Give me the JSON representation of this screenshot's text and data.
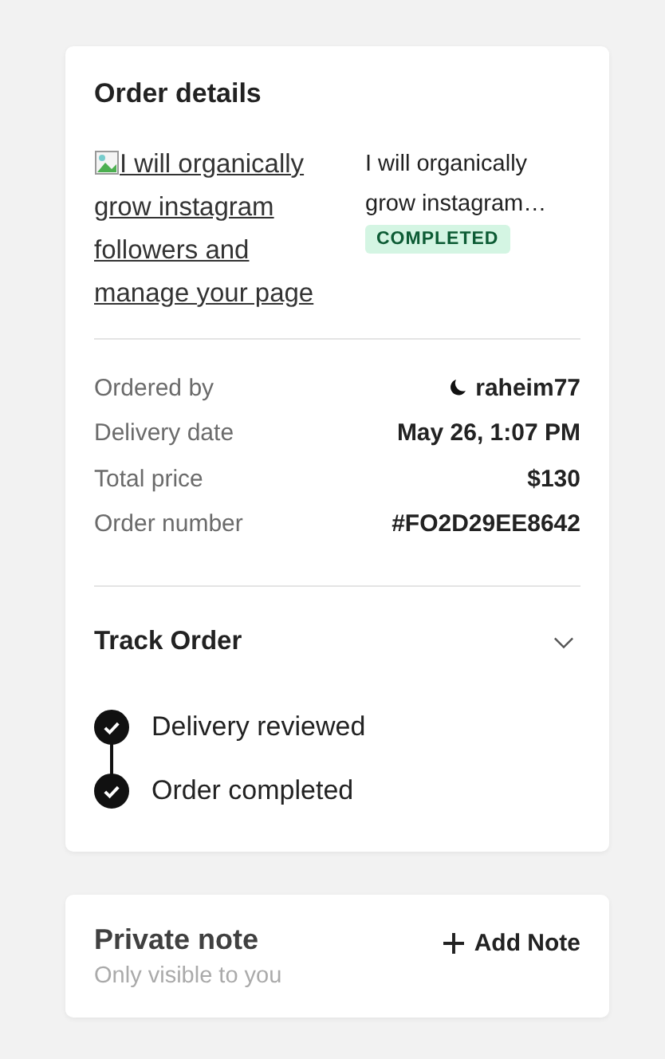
{
  "order_details": {
    "title": "Order details",
    "gig": {
      "image_alt": "I will organically grow instagram followers and manage your page",
      "title": "I will organically grow instagram…",
      "status": "COMPLETED"
    },
    "info": [
      {
        "label": "Ordered by",
        "value": "raheim77",
        "kind": "user"
      },
      {
        "label": "Delivery date",
        "value": "May 26, 1:07 PM",
        "kind": "text"
      },
      {
        "label": "Total price",
        "value": "$130",
        "kind": "text"
      },
      {
        "label": "Order number",
        "value": "#FO2D29EE8642",
        "kind": "text"
      }
    ],
    "track": {
      "title": "Track Order",
      "expanded": true,
      "steps": [
        {
          "label": "Delivery reviewed",
          "done": true
        },
        {
          "label": "Order completed",
          "done": true
        }
      ]
    }
  },
  "private_note": {
    "title": "Private note",
    "subtitle": "Only visible to you",
    "action": "Add Note"
  }
}
